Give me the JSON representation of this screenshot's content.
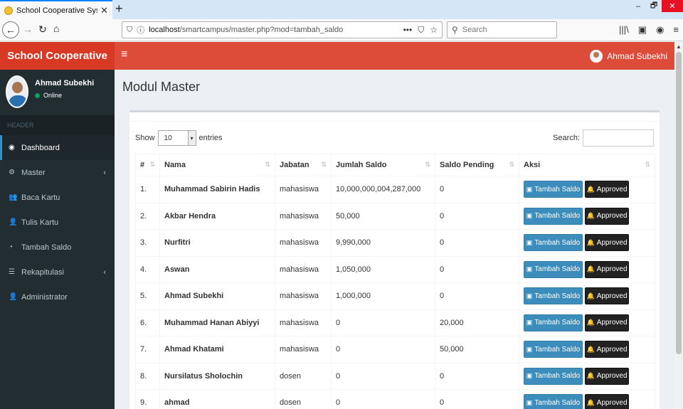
{
  "browser": {
    "tab_title": "School Cooperative System",
    "tab_close": "✕",
    "new_tab": "+",
    "url_host": "localhost",
    "url_path": "/smartcampus/master.php?mod=tambah_saldo",
    "search_placeholder": "Search",
    "win_min": "–",
    "win_restore": "🗗",
    "win_close": "✕"
  },
  "app": {
    "logo": "School Cooperative",
    "menu_toggle": "≡",
    "header_user": "Ahmad Subekhi"
  },
  "sidebar": {
    "user_name": "Ahmad Subekhi",
    "user_status": "Online",
    "section_header": "HEADER",
    "items": [
      {
        "label": "Dashboard",
        "icon": "dashboard-icon",
        "glyph": "◉",
        "active": true,
        "chevron": ""
      },
      {
        "label": "Master",
        "icon": "cogs-icon",
        "glyph": "⚙",
        "active": false,
        "chevron": "‹"
      },
      {
        "label": "Baca Kartu",
        "icon": "users-icon",
        "glyph": "👥",
        "active": false,
        "chevron": ""
      },
      {
        "label": "Tulis Kartu",
        "icon": "user-icon",
        "glyph": "👤",
        "active": false,
        "chevron": ""
      },
      {
        "label": "Tambah Saldo",
        "icon": "pie-chart-icon",
        "glyph": "◔",
        "active": false,
        "chevron": ""
      },
      {
        "label": "Rekapitulasi",
        "icon": "list-icon",
        "glyph": "☰",
        "active": false,
        "chevron": "‹"
      },
      {
        "label": "Administrator",
        "icon": "user-icon",
        "glyph": "👤",
        "active": false,
        "chevron": ""
      }
    ]
  },
  "page": {
    "title": "Modul Master",
    "show_label": "Show",
    "entries_value": "10",
    "entries_label": "entries",
    "search_label": "Search:",
    "search_value": ""
  },
  "table": {
    "columns": [
      "#",
      "Nama",
      "Jabatan",
      "Jumlah Saldo",
      "Saldo Pending",
      "Aksi"
    ],
    "rows": [
      {
        "no": "1.",
        "nama": "Muhammad Sabirin Hadis",
        "jabatan": "mahasiswa",
        "saldo": "10,000,000,004,287,000",
        "pending": "0"
      },
      {
        "no": "2.",
        "nama": "Akbar Hendra",
        "jabatan": "mahasiswa",
        "saldo": "50,000",
        "pending": "0"
      },
      {
        "no": "3.",
        "nama": "Nurfitri",
        "jabatan": "mahasiswa",
        "saldo": "9,990,000",
        "pending": "0"
      },
      {
        "no": "4.",
        "nama": "Aswan",
        "jabatan": "mahasiswa",
        "saldo": "1,050,000",
        "pending": "0"
      },
      {
        "no": "5.",
        "nama": "Ahmad Subekhi",
        "jabatan": "mahasiswa",
        "saldo": "1,000,000",
        "pending": "0"
      },
      {
        "no": "6.",
        "nama": "Muhammad Hanan Abiyyi",
        "jabatan": "mahasiswa",
        "saldo": "0",
        "pending": "20,000"
      },
      {
        "no": "7.",
        "nama": "Ahmad Khatami",
        "jabatan": "mahasiswa",
        "saldo": "0",
        "pending": "50,000"
      },
      {
        "no": "8.",
        "nama": "Nursilatus Sholochin",
        "jabatan": "dosen",
        "saldo": "0",
        "pending": "0"
      },
      {
        "no": "9.",
        "nama": "ahmad",
        "jabatan": "dosen",
        "saldo": "0",
        "pending": "0"
      }
    ],
    "btn_tambah": "Tambah Saldo",
    "btn_approved": "Approved"
  },
  "colors": {
    "header_red": "#dd4b39",
    "sidebar_dark": "#222d32",
    "primary_blue": "#3c8dbc",
    "dark_button": "#222222"
  }
}
